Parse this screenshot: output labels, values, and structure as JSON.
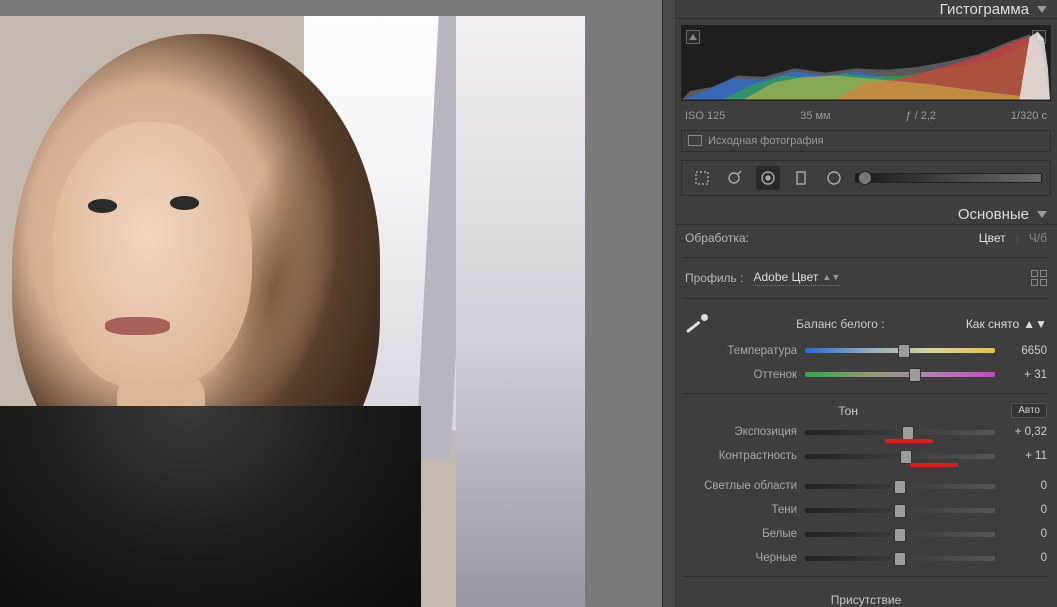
{
  "histogram": {
    "title": "Гистограмма",
    "iso": "ISO 125",
    "focal": "35 мм",
    "aperture": "ƒ / 2,2",
    "shutter": "1/320 с",
    "original_label": "Исходная фотография"
  },
  "basic": {
    "title": "Основные",
    "treatment_label": "Обработка:",
    "treatment_color": "Цвет",
    "treatment_bw": "Ч/б",
    "profile_label": "Профиль :",
    "profile_value": "Adobe Цвет",
    "wb_label": "Баланс белого :",
    "wb_value": "Как снято",
    "temp_label": "Температура",
    "temp_value": "6650",
    "tint_label": "Оттенок",
    "tint_value": "+ 31",
    "tone_header": "Тон",
    "auto_label": "Авто",
    "exposure_label": "Экспозиция",
    "exposure_value": "+ 0,32",
    "contrast_label": "Контрастность",
    "contrast_value": "+ 11",
    "highlights_label": "Светлые области",
    "highlights_value": "0",
    "shadows_label": "Тени",
    "shadows_value": "0",
    "whites_label": "Белые",
    "whites_value": "0",
    "blacks_label": "Черные",
    "blacks_value": "0",
    "presence_header": "Присутствие"
  },
  "slider_pos": {
    "temp": 52,
    "tint": 58,
    "exposure": 54,
    "contrast": 53,
    "highlights": 50,
    "shadows": 50,
    "whites": 50,
    "blacks": 50
  }
}
